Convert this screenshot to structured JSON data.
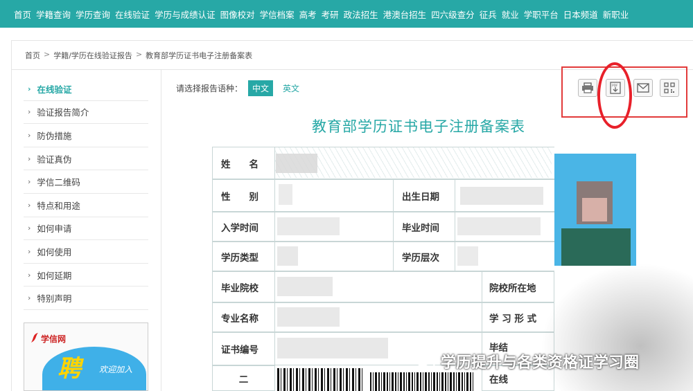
{
  "nav": [
    "首页",
    "学籍查询",
    "学历查询",
    "在线验证",
    "学历与成绩认证",
    "图像校对",
    "学信档案",
    "高考",
    "考研",
    "政法招生",
    "港澳台招生",
    "四六级查分",
    "征兵",
    "就业",
    "学职平台",
    "日本频道",
    "新职业"
  ],
  "breadcrumb": [
    "首页",
    "学籍/学历在线验证报告",
    "教育部学历证书电子注册备案表"
  ],
  "sidebar": [
    "在线验证",
    "验证报告简介",
    "防伪措施",
    "验证真伪",
    "学信二维码",
    "特点和用途",
    "如何申请",
    "如何使用",
    "如何延期",
    "特别声明"
  ],
  "banner": {
    "logo": "学信网",
    "big": "聘",
    "small": "欢迎加入"
  },
  "lang": {
    "prompt": "请选择报告语种：",
    "zh": "中文",
    "en": "英文"
  },
  "doc_title": "教育部学历证书电子注册备案表",
  "fields": {
    "name": "姓　　名",
    "gender": "性　　别",
    "birth": "出生日期",
    "enroll": "入学时间",
    "graduate": "毕业时间",
    "edu_type": "学历类型",
    "edu_level": "学历层次",
    "school": "毕业院校",
    "school_loc": "院校所在地",
    "major": "专业名称",
    "study_form": "学 习 形 式",
    "cert_no": "证书编号",
    "graduation_partial": "毕结",
    "qr_label": "二",
    "online": "在线"
  },
  "watermark": "学历提升与各类资格证学习圈",
  "colors": {
    "accent": "#27a8a6",
    "highlight": "#e8202a"
  }
}
